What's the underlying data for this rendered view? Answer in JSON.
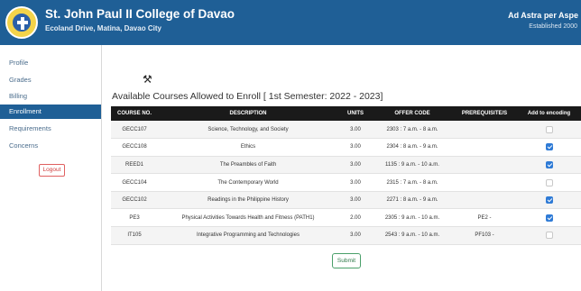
{
  "header": {
    "school_name": "St. John Paul II College of Davao",
    "address": "Ecoland Drive, Matina, Davao City",
    "motto": "Ad Astra per Aspe",
    "established": "Established 2000"
  },
  "sidebar": {
    "items": [
      {
        "label": "Profile",
        "active": false
      },
      {
        "label": "Grades",
        "active": false
      },
      {
        "label": "Billing",
        "active": false
      },
      {
        "label": "Enrollment",
        "active": true
      },
      {
        "label": "Requirements",
        "active": false
      },
      {
        "label": "Concerns",
        "active": false
      }
    ],
    "logout_label": "Logout"
  },
  "main": {
    "tool_icon": "⚒",
    "title": "Available Courses Allowed to Enroll [ 1st Semester: 2022 - 2023]",
    "columns": [
      "COURSE NO.",
      "DESCRIPTION",
      "UNITS",
      "OFFER CODE",
      "PREREQUISITE/S",
      "Add to encoding"
    ],
    "rows": [
      {
        "course_no": "GECC107",
        "description": "Science, Technology, and Society",
        "units": "3.00",
        "offer_code": "2303 : 7 a.m. - 8 a.m.",
        "prereq": "",
        "checked": false
      },
      {
        "course_no": "GECC108",
        "description": "Ethics",
        "units": "3.00",
        "offer_code": "2304 : 8 a.m. - 9 a.m.",
        "prereq": "",
        "checked": true
      },
      {
        "course_no": "REED1",
        "description": "The Preambles of Faith",
        "units": "3.00",
        "offer_code": "1135 : 9 a.m. - 10 a.m.",
        "prereq": "",
        "checked": true
      },
      {
        "course_no": "GECC104",
        "description": "The Contemporary World",
        "units": "3.00",
        "offer_code": "2315 : 7 a.m. - 8 a.m.",
        "prereq": "",
        "checked": false
      },
      {
        "course_no": "GECC102",
        "description": "Readings in the Philippine History",
        "units": "3.00",
        "offer_code": "2271 : 8 a.m. - 9 a.m.",
        "prereq": "",
        "checked": true
      },
      {
        "course_no": "PE3",
        "description": "Physical Activities Towards Health and Fitness (PATH1)",
        "units": "2.00",
        "offer_code": "2305 : 9 a.m. - 10 a.m.",
        "prereq": "PE2 -",
        "checked": true
      },
      {
        "course_no": "IT105",
        "description": "Integrative Programming and Technologies",
        "units": "3.00",
        "offer_code": "2543 : 9 a.m. - 10 a.m.",
        "prereq": "PF103 -",
        "checked": false
      }
    ],
    "submit_label": "Submit"
  },
  "colors": {
    "header_bg": "#1f5f96",
    "active_nav": "#1f5f96",
    "table_header": "#1a1a1a",
    "checkbox_on": "#2f7bd6",
    "submit_border": "#4aa06a",
    "logout_border": "#e06060"
  },
  "icons": {
    "logo": "school-seal-logo",
    "tool": "tools-icon"
  }
}
